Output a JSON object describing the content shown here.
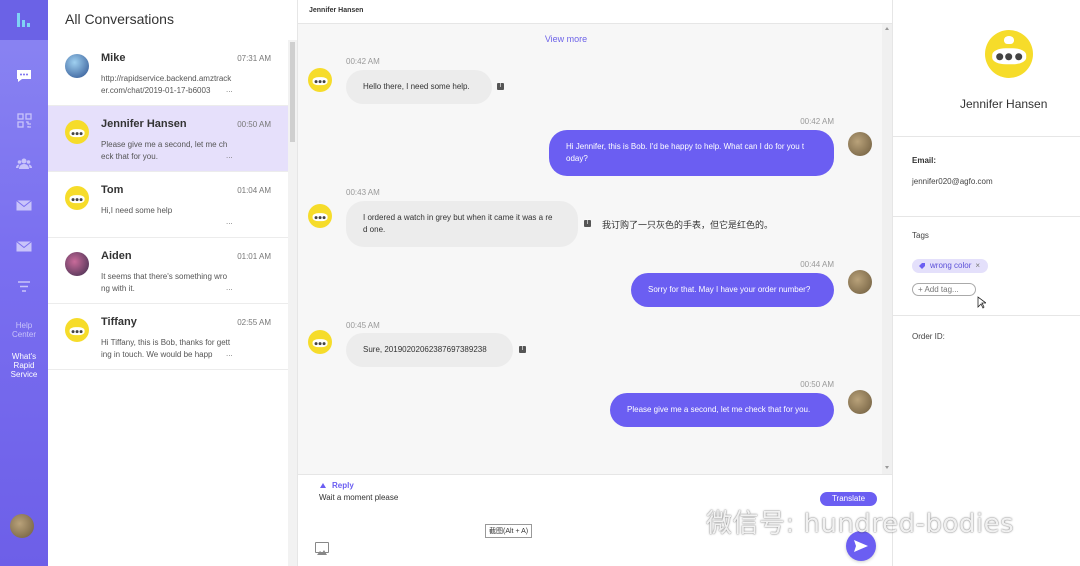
{
  "nav": {
    "logo": "app-logo",
    "items": [
      {
        "name": "chat",
        "icon": "chat-bubble-icon"
      },
      {
        "name": "qr",
        "icon": "qr-code-icon"
      },
      {
        "name": "contacts",
        "icon": "people-icon"
      },
      {
        "name": "mail",
        "icon": "mail-icon"
      },
      {
        "name": "mail2",
        "icon": "mail-icon"
      },
      {
        "name": "filter",
        "icon": "filter-lines-icon"
      }
    ],
    "help_center": "Help\nCenter",
    "whats_rapid": "What's\nRapid\nService"
  },
  "list": {
    "title": "All Conversations",
    "conversations": [
      {
        "name": "Mike",
        "time": "07:31 AM",
        "preview": "http://rapidservice.backend.amztrack\ner.com/chat/2019-01-17-b6003 ",
        "dots": "...",
        "avatar": "photo"
      },
      {
        "name": "Jennifer Hansen",
        "time": "00:50 AM",
        "preview": "Please give me a second, let me ch\neck that for you.",
        "dots": "...",
        "avatar": "bot",
        "active": true
      },
      {
        "name": "Tom",
        "time": "01:04 AM",
        "preview": "Hi,I need some help",
        "dots": "...",
        "avatar": "bot"
      },
      {
        "name": "Aiden",
        "time": "01:01 AM",
        "preview": "It seems that there's something wro\nng with it.",
        "dots": "...",
        "avatar": "photo"
      },
      {
        "name": "Tiffany",
        "time": "02:55 AM",
        "preview": "Hi Tiffany, this is Bob, thanks for gett\ning in touch. We would be happ",
        "dots": "...",
        "avatar": "bot"
      }
    ]
  },
  "chat": {
    "header_title": "Jennifer Hansen",
    "view_more": "View more",
    "messages": [
      {
        "dir": "in",
        "time": "00:42 AM",
        "text": "Hello there, I need some help."
      },
      {
        "dir": "out",
        "time": "00:42 AM",
        "text": "Hi Jennifer, this is Bob. I'd be happy to help. What can I do for you t\noday?"
      },
      {
        "dir": "in",
        "time": "00:43 AM",
        "text": "I ordered a watch in grey but when it came it was a re\nd one.",
        "translation": "我订购了一只灰色的手表，但它是红色的。"
      },
      {
        "dir": "out",
        "time": "00:44 AM",
        "text": "Sorry for that. May I have your order number?"
      },
      {
        "dir": "in",
        "time": "00:45 AM",
        "text": "Sure, 20190202062387697389238"
      },
      {
        "dir": "out",
        "time": "00:50 AM",
        "text": "Please give me a second, let me check that for you."
      }
    ],
    "translate_icon": "T",
    "composer": {
      "reply_label": "Reply",
      "text": "Wait a moment please",
      "translate_button": "Translate",
      "screenshot_tip": "截图(Alt + A)"
    }
  },
  "panel": {
    "name": "Jennifer Hansen",
    "email_label": "Email:",
    "email": "jennifer020@agfo.com",
    "tags_label": "Tags",
    "tag": "wrong color",
    "tag_remove": "×",
    "add_tag": "Add tag...",
    "add_tag_plus": "+",
    "order_label": "Order ID:"
  },
  "watermark": "微信号: hundred-bodies",
  "colors": {
    "accent": "#6b5ef2",
    "nav_bg": "#7a6ff0",
    "active_row": "#e6e0fb",
    "bot_yellow": "#f6dc2a"
  }
}
